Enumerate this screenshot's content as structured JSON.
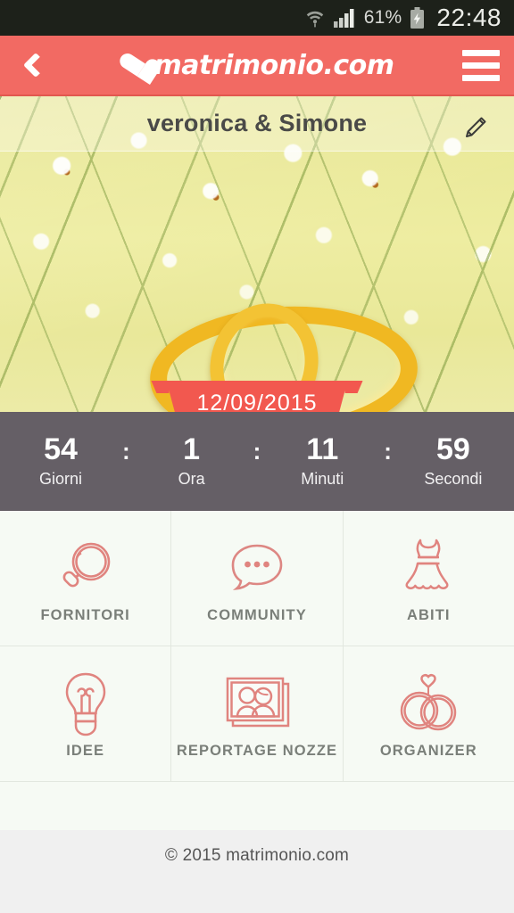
{
  "statusbar": {
    "wifi_icon": "wifi-icon",
    "signal_icon": "signal-bars-icon",
    "battery_percent": "61%",
    "battery_icon": "battery-charging-icon",
    "time": "22:48"
  },
  "appbar": {
    "back_icon": "chevron-left-icon",
    "logo_heart_icon": "heart-icon",
    "logo_text": "matrimonio.com",
    "menu_icon": "hamburger-menu-icon",
    "background_color": "#f26a63"
  },
  "hero": {
    "couple_names": "veronica & Simone",
    "edit_icon": "pencil-edit-icon",
    "wedding_date": "12/09/2015",
    "ribbon_color": "#f2584f"
  },
  "countdown": {
    "background_color": "#655f66",
    "separator": ":",
    "units": [
      {
        "value": "54",
        "label": "Giorni"
      },
      {
        "value": "1",
        "label": "Ora"
      },
      {
        "value": "11",
        "label": "Minuti"
      },
      {
        "value": "59",
        "label": "Secondi"
      }
    ]
  },
  "grid": {
    "accent_color": "#e08a85",
    "rows": [
      [
        {
          "label": "FORNITORI",
          "icon": "magnifier-icon"
        },
        {
          "label": "COMMUNITY",
          "icon": "speech-bubble-icon"
        },
        {
          "label": "ABITI",
          "icon": "dress-icon"
        }
      ],
      [
        {
          "label": "IDEE",
          "icon": "lightbulb-icon"
        },
        {
          "label": "REPORTAGE NOZZE",
          "icon": "photo-stack-icon"
        },
        {
          "label": "ORGANIZER",
          "icon": "wedding-rings-icon"
        }
      ]
    ]
  },
  "footer": {
    "copyright": "© 2015 matrimonio.com"
  }
}
